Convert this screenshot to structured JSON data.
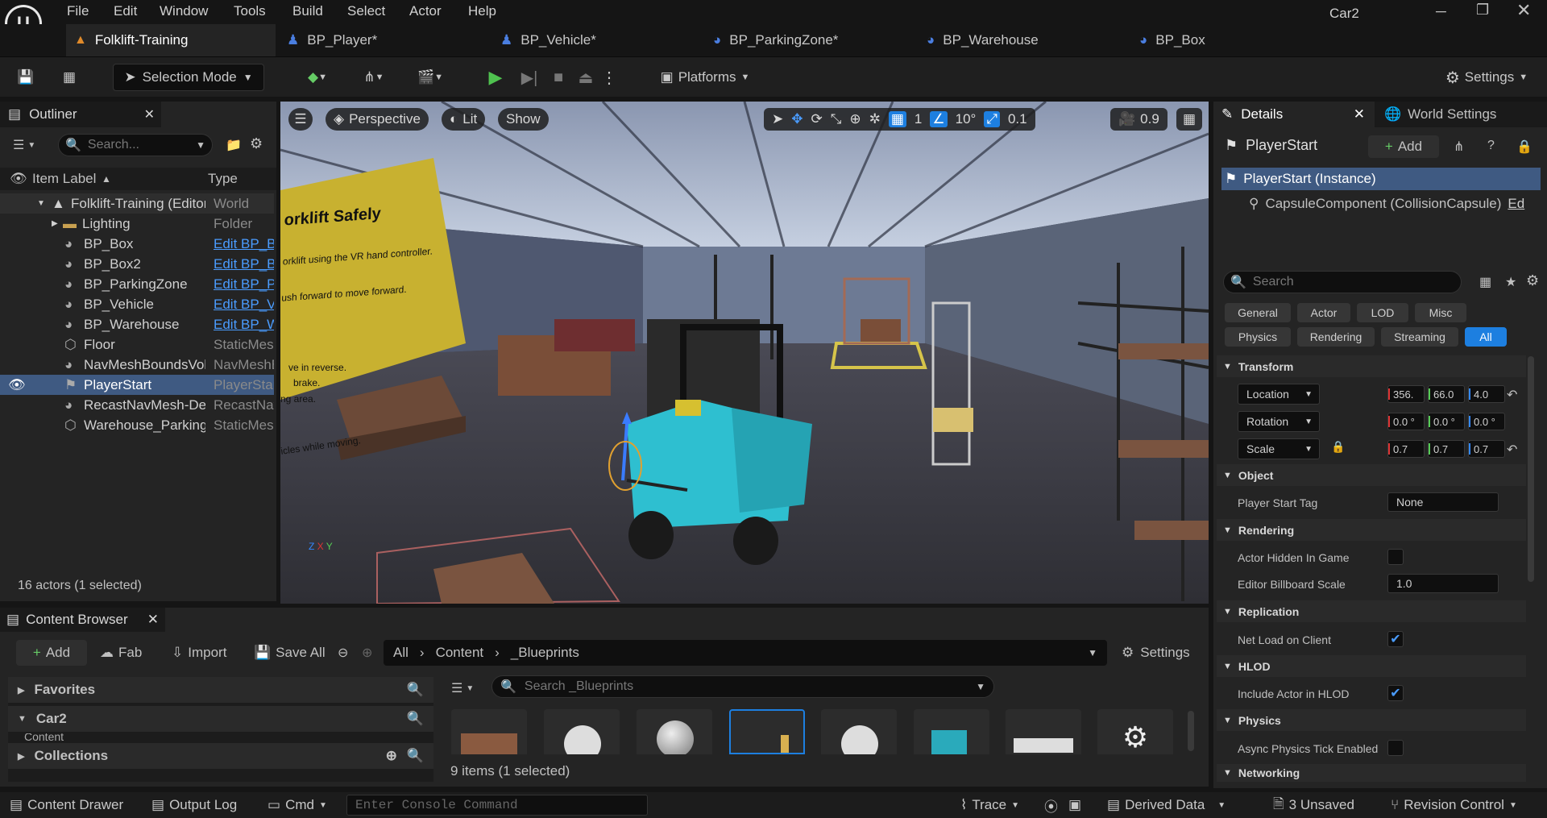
{
  "app": {
    "window_title": "Car2",
    "accent": "#1d7fe0"
  },
  "menu": [
    "File",
    "Edit",
    "Window",
    "Tools",
    "Build",
    "Select",
    "Actor",
    "Help"
  ],
  "tabs": [
    {
      "label": "Folklift-Training",
      "icon": "level-icon",
      "active": true
    },
    {
      "label": "BP_Player*",
      "icon": "pawn-icon"
    },
    {
      "label": "BP_Vehicle*",
      "icon": "pawn-icon"
    },
    {
      "label": "BP_ParkingZone*",
      "icon": "blueprint-icon"
    },
    {
      "label": "BP_Warehouse",
      "icon": "blueprint-icon"
    },
    {
      "label": "BP_Box",
      "icon": "blueprint-icon"
    }
  ],
  "toolbar": {
    "selection_mode": "Selection Mode",
    "platforms": "Platforms",
    "settings": "Settings"
  },
  "outliner": {
    "title": "Outliner",
    "search_placeholder": "Search...",
    "col_label": "Item Label",
    "col_type": "Type",
    "rows": [
      {
        "label": "Folklift-Training (Editor)",
        "type": "World",
        "link": false
      },
      {
        "label": "Lighting",
        "type": "Folder",
        "link": false
      },
      {
        "label": "BP_Box",
        "type": "Edit BP_Box",
        "link": true
      },
      {
        "label": "BP_Box2",
        "type": "Edit BP_Box",
        "link": true
      },
      {
        "label": "BP_ParkingZone",
        "type": "Edit BP_ParkingZone",
        "link": true
      },
      {
        "label": "BP_Vehicle",
        "type": "Edit BP_Vehicle",
        "link": true
      },
      {
        "label": "BP_Warehouse",
        "type": "Edit BP_Warehouse",
        "link": true
      },
      {
        "label": "Floor",
        "type": "StaticMeshActor",
        "link": false
      },
      {
        "label": "NavMeshBoundsVolume",
        "type": "NavMeshBoundsVolume",
        "link": false
      },
      {
        "label": "PlayerStart",
        "type": "PlayerStart",
        "link": false
      },
      {
        "label": "RecastNavMesh-Default",
        "type": "RecastNavMesh",
        "link": false
      },
      {
        "label": "Warehouse_Parking",
        "type": "StaticMeshActor",
        "link": false
      }
    ],
    "status": "16 actors (1 selected)"
  },
  "viewport": {
    "perspective": "Perspective",
    "lit": "Lit",
    "show": "Show",
    "grid": "1",
    "angle": "10°",
    "scale": "0.1",
    "camera_speed": "0.9",
    "poster_title": "orklift Safely",
    "poster_lines": [
      "orklift using the VR hand controller.",
      "ush forward to move forward.",
      "ve in reverse.",
      "brake.",
      "ng area.",
      "icles while moving."
    ]
  },
  "details": {
    "tab": "Details",
    "tab2": "World Settings",
    "actor": "PlayerStart",
    "add": "Add",
    "instance": "PlayerStart (Instance)",
    "component": "CapsuleComponent (CollisionCapsule)",
    "component_edit": "Ed",
    "search_placeholder": "Search",
    "filters_row1": [
      "General",
      "Actor",
      "LOD",
      "Misc"
    ],
    "filters_row2": [
      "Physics",
      "Rendering",
      "Streaming",
      "All"
    ],
    "transform": "Transform",
    "location": {
      "label": "Location",
      "x": "356.",
      "y": "66.0",
      "z": "4.0"
    },
    "rotation": {
      "label": "Rotation",
      "x": "0.0 °",
      "y": "0.0 °",
      "z": "0.0 °"
    },
    "scale": {
      "label": "Scale",
      "x": "0.7",
      "y": "0.7",
      "z": "0.7"
    },
    "object": "Object",
    "player_start_tag": "Player Start Tag",
    "player_start_tag_value": "None",
    "rendering": "Rendering",
    "actor_hidden": "Actor Hidden In Game",
    "billboard_scale": "Editor Billboard Scale",
    "billboard_value": "1.0",
    "replication": "Replication",
    "net_load": "Net Load on Client",
    "hlod": "HLOD",
    "include_hlod": "Include Actor in HLOD",
    "physics": "Physics",
    "async_physics": "Async Physics Tick Enabled",
    "networking": "Networking"
  },
  "content_browser": {
    "title": "Content Browser",
    "add": "Add",
    "fab": "Fab",
    "import": "Import",
    "save_all": "Save All",
    "path": [
      "All",
      "Content",
      "_Blueprints"
    ],
    "settings": "Settings",
    "favorites": "Favorites",
    "project": "Car2",
    "content_folder": "Content",
    "collections": "Collections",
    "search_placeholder": "Search _Blueprints",
    "status": "9 items (1 selected)"
  },
  "statusbar": {
    "content_drawer": "Content Drawer",
    "output_log": "Output Log",
    "cmd": "Cmd",
    "console_placeholder": "Enter Console Command",
    "trace": "Trace",
    "derived_data": "Derived Data",
    "unsaved": "3 Unsaved",
    "revision_control": "Revision Control"
  }
}
